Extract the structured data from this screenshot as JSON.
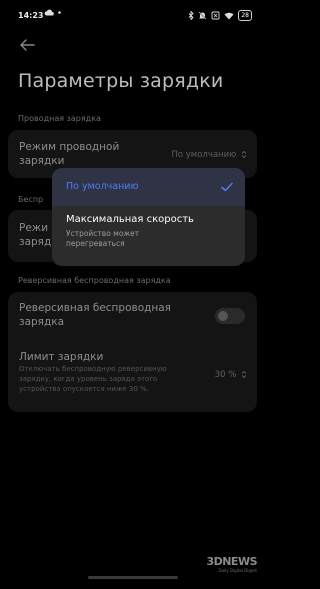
{
  "status_bar": {
    "time": "14:23",
    "battery": "28",
    "left_icons": [
      "cloud-icon",
      "more-dots-icon"
    ],
    "right_icons": [
      "bluetooth-icon",
      "silent-icon",
      "no-sim-icon",
      "wifi-icon",
      "battery-icon"
    ]
  },
  "page": {
    "title": "Параметры зарядки"
  },
  "sections": {
    "wired_label": "Проводная зарядка",
    "wireless_label": "Беспр",
    "reverse_label": "Реверсивная беспроводная зарядка"
  },
  "wired_mode": {
    "title": "Режим проводной зарядки",
    "value": "По умолчанию"
  },
  "wireless_mode": {
    "title_partial": "Режи",
    "title_partial2": "заряд"
  },
  "reverse": {
    "title": "Реверсивная беспроводная зарядка",
    "toggle_on": false
  },
  "limit": {
    "title": "Лимит зарядки",
    "description": "Отключать беспроводную реверсивную зарядку, когда уровень заряда этого устройства опускается ниже 30 %.",
    "value": "30 %"
  },
  "dropdown": {
    "options": [
      {
        "label": "По умолчанию",
        "selected": true
      },
      {
        "label": "Максимальная скорость",
        "description": "Устройство может перегреваться",
        "selected": false
      }
    ]
  },
  "watermark": {
    "brand": "3DNEWS",
    "tagline": "Daily Digital Digest"
  },
  "colors": {
    "accent": "#4f7cf5",
    "background": "#000000",
    "card": "#141414",
    "dropdown": "#2c2c2c"
  }
}
